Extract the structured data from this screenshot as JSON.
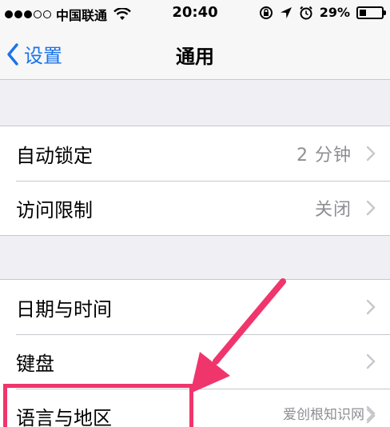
{
  "status_bar": {
    "carrier": "中国联通",
    "time": "20:40",
    "battery_percent": "29%",
    "battery_level": 0.29
  },
  "nav": {
    "back_label": "设置",
    "title": "通用"
  },
  "group1": [
    {
      "label": "自动锁定",
      "value": "2 分钟"
    },
    {
      "label": "访问限制",
      "value": "关闭"
    }
  ],
  "group2": [
    {
      "label": "日期与时间"
    },
    {
      "label": "键盘"
    },
    {
      "label": "语言与地区"
    }
  ],
  "watermark": "爱创根知识网",
  "colors": {
    "accent": "#1a73ea",
    "annotation": "#f0356c",
    "secondary_text": "#8e8e93",
    "background": "#efeff4"
  },
  "icons": [
    "wifi-icon",
    "rotation-lock-icon",
    "location-arrow-icon",
    "alarm-icon",
    "battery-icon",
    "chevron-left-icon",
    "chevron-right-icon"
  ]
}
